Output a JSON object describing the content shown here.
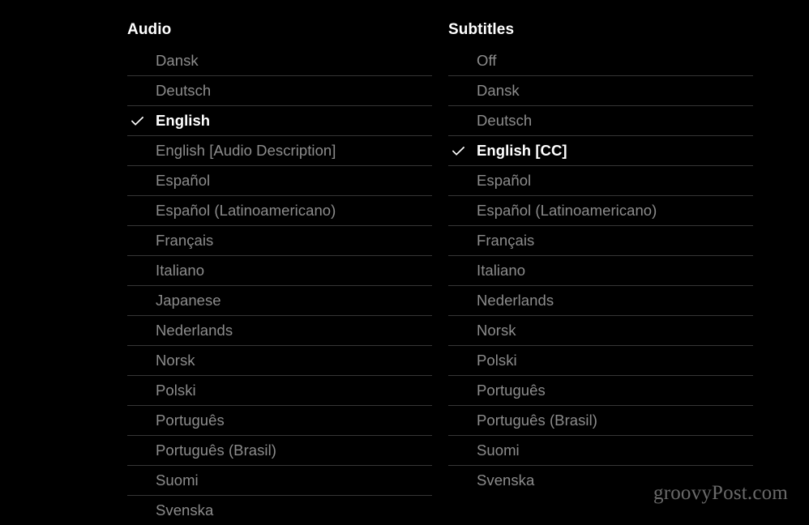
{
  "background_color": "#000000",
  "colors": {
    "selected_text": "#ffffff",
    "inactive_text": "#8c8c8c",
    "divider": "#363636",
    "watermark_text": "#6a6a6a"
  },
  "columns": [
    {
      "id": "audio",
      "title": "Audio",
      "options": [
        {
          "label": "Dansk",
          "selected": false
        },
        {
          "label": "Deutsch",
          "selected": false
        },
        {
          "label": "English",
          "selected": true
        },
        {
          "label": "English [Audio Description]",
          "selected": false
        },
        {
          "label": "Español",
          "selected": false
        },
        {
          "label": "Español (Latinoamericano)",
          "selected": false
        },
        {
          "label": "Français",
          "selected": false
        },
        {
          "label": "Italiano",
          "selected": false
        },
        {
          "label": "Japanese",
          "selected": false
        },
        {
          "label": "Nederlands",
          "selected": false
        },
        {
          "label": "Norsk",
          "selected": false
        },
        {
          "label": "Polski",
          "selected": false
        },
        {
          "label": "Português",
          "selected": false
        },
        {
          "label": "Português (Brasil)",
          "selected": false
        },
        {
          "label": "Suomi",
          "selected": false
        },
        {
          "label": "Svenska",
          "selected": false
        }
      ]
    },
    {
      "id": "subtitles",
      "title": "Subtitles",
      "options": [
        {
          "label": "Off",
          "selected": false
        },
        {
          "label": "Dansk",
          "selected": false
        },
        {
          "label": "Deutsch",
          "selected": false
        },
        {
          "label": "English [CC]",
          "selected": true
        },
        {
          "label": "Español",
          "selected": false
        },
        {
          "label": "Español (Latinoamericano)",
          "selected": false
        },
        {
          "label": "Français",
          "selected": false
        },
        {
          "label": "Italiano",
          "selected": false
        },
        {
          "label": "Nederlands",
          "selected": false
        },
        {
          "label": "Norsk",
          "selected": false
        },
        {
          "label": "Polski",
          "selected": false
        },
        {
          "label": "Português",
          "selected": false
        },
        {
          "label": "Português (Brasil)",
          "selected": false
        },
        {
          "label": "Suomi",
          "selected": false
        },
        {
          "label": "Svenska",
          "selected": false
        }
      ]
    }
  ],
  "watermark": {
    "text": "groovyPost.com"
  },
  "icons": {
    "check": "check-icon"
  }
}
